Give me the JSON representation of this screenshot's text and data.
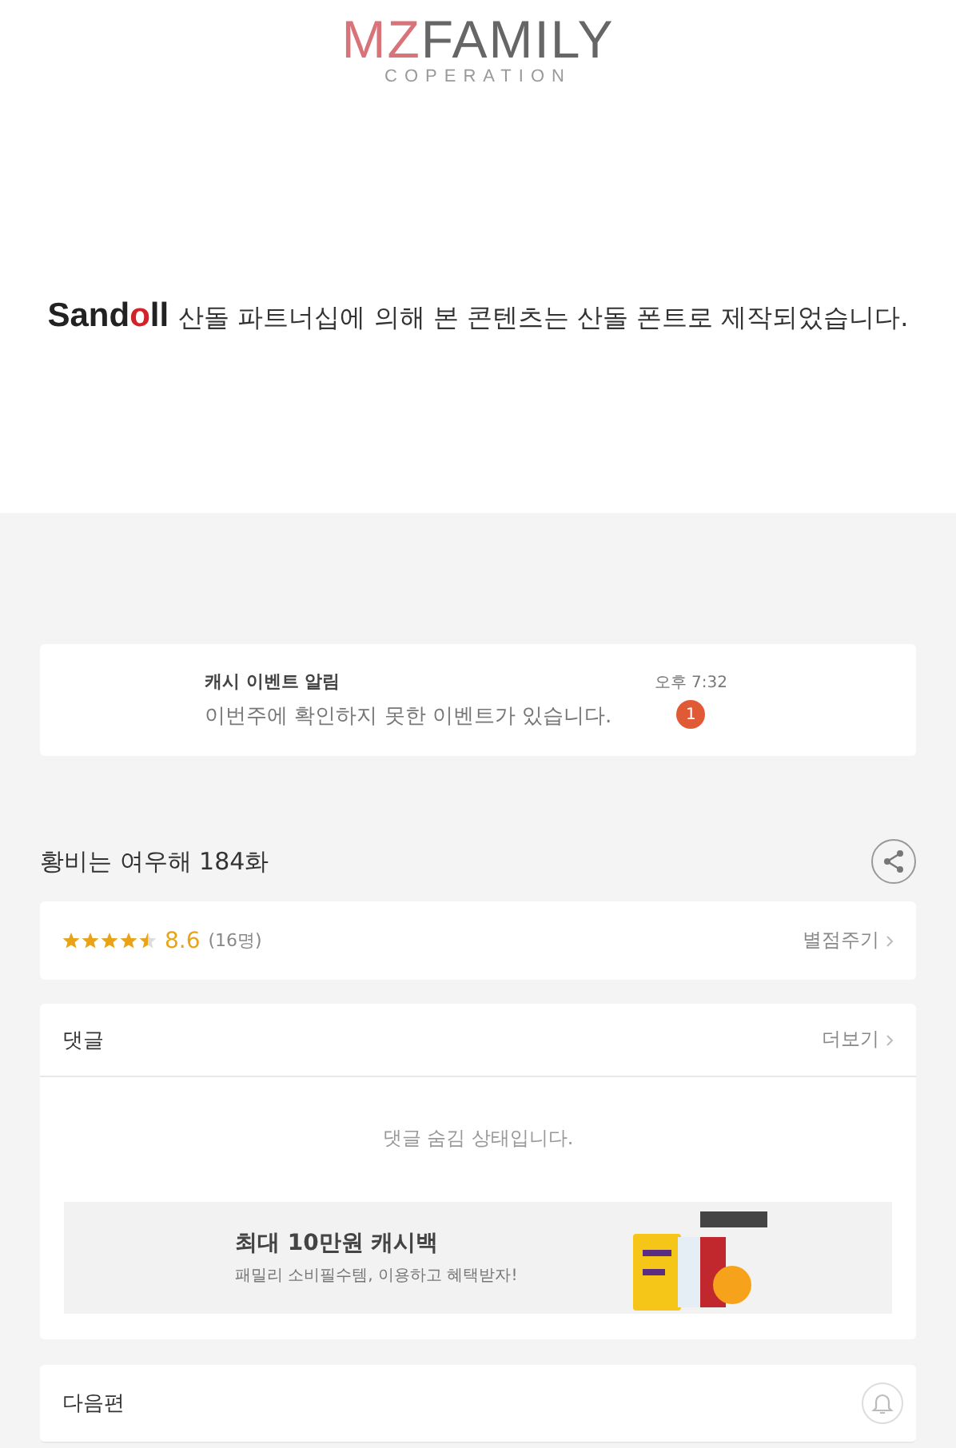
{
  "brand_logo": {
    "accent": "MZ",
    "rest": "FAMILY",
    "tagline": "COPERATION"
  },
  "font_notice": {
    "logo": {
      "start": "Sand",
      "accent": "o",
      "end": "ll"
    },
    "text": "산돌 파트너십에 의해 본 콘텐츠는 산돌 폰트로 제작되었습니다."
  },
  "notification": {
    "title": "캐시 이벤트 알림",
    "message": "이번주에 확인하지 못한 이벤트가 있습니다.",
    "time": "오후 7:32",
    "badge": "1"
  },
  "episode": {
    "title": "황비는 여우해 184화"
  },
  "rating": {
    "stars": 4.5,
    "score": "8.6",
    "count": "(16명)",
    "action": "별점주기"
  },
  "comments": {
    "title": "댓글",
    "more": "더보기",
    "message": "댓글 숨김 상태입니다.",
    "ad": {
      "headline": "최대 10만원 캐시백",
      "subtitle": "패밀리 소비필수템, 이용하고 혜택받자!"
    }
  },
  "next": {
    "title": "다음편"
  }
}
